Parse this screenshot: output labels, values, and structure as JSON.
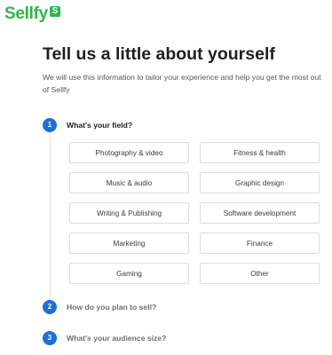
{
  "brand": {
    "name": "Sellfy",
    "badge": "S",
    "color": "#2fb44a"
  },
  "header": {
    "title": "Tell us a little about yourself",
    "subtitle": "We will use this information to tailor your experience and help you get the most out of Sellfy"
  },
  "accent_color": "#1f6fd6",
  "steps": [
    {
      "number": "1",
      "label": "What's your field?",
      "active": true,
      "options": [
        "Photography & video",
        "Fitness & health",
        "Music & audio",
        "Graphic design",
        "Writing & Publishing",
        "Software development",
        "Marketing",
        "Finance",
        "Gaming",
        "Other"
      ]
    },
    {
      "number": "2",
      "label": "How do you plan to sell?",
      "active": false
    },
    {
      "number": "3",
      "label": "What's your audience size?",
      "active": false
    }
  ]
}
